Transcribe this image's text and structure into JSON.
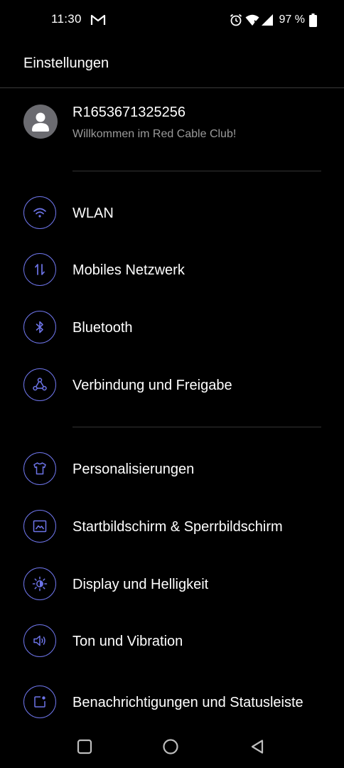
{
  "status_bar": {
    "time": "11:30",
    "notification_icon": "gmail-icon",
    "battery_percent": "97 %",
    "icons": [
      "alarm-icon",
      "wifi-icon",
      "signal-icon",
      "battery-icon"
    ]
  },
  "header": {
    "title": "Einstellungen"
  },
  "account": {
    "name": "R1653671325256",
    "subtitle": "Willkommen im Red Cable Club!"
  },
  "sections": [
    {
      "items": [
        {
          "label": "WLAN",
          "icon": "wifi-icon"
        },
        {
          "label": "Mobiles Netzwerk",
          "icon": "mobile-data-icon"
        },
        {
          "label": "Bluetooth",
          "icon": "bluetooth-icon"
        },
        {
          "label": "Verbindung und Freigabe",
          "icon": "connection-share-icon"
        }
      ]
    },
    {
      "items": [
        {
          "label": "Personalisierungen",
          "icon": "tshirt-icon"
        },
        {
          "label": "Startbildschirm & Sperrbildschirm",
          "icon": "wallpaper-icon"
        },
        {
          "label": "Display und Helligkeit",
          "icon": "brightness-icon"
        },
        {
          "label": "Ton und Vibration",
          "icon": "speaker-icon"
        },
        {
          "label": "Benachrichtigungen und Statusleiste",
          "icon": "notification-icon"
        }
      ]
    }
  ],
  "colors": {
    "background": "#000000",
    "accent": "#6d74e8",
    "text_primary": "#ffffff",
    "text_secondary": "#9a9a9a"
  },
  "nav_bar": {
    "buttons": [
      "recents-button",
      "home-button",
      "back-button"
    ]
  }
}
